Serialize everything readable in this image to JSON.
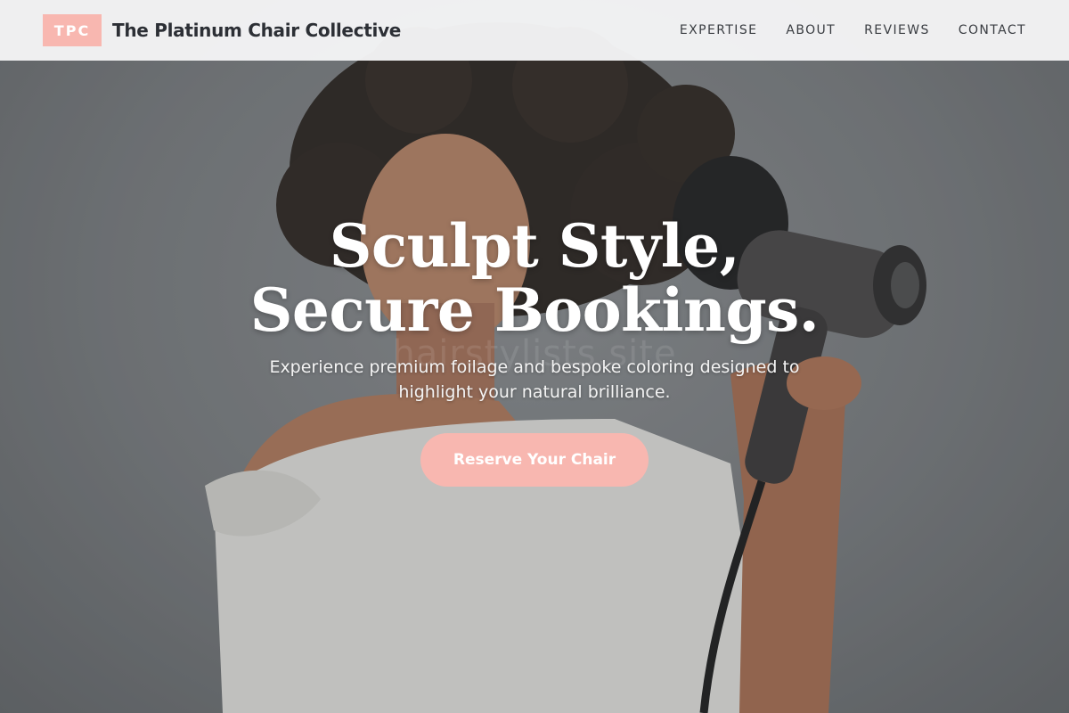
{
  "header": {
    "logo_text": "TPC",
    "brand_name": "The Platinum Chair Collective",
    "nav": [
      {
        "label": "EXPERTISE"
      },
      {
        "label": "ABOUT"
      },
      {
        "label": "REVIEWS"
      },
      {
        "label": "CONTACT"
      }
    ]
  },
  "hero": {
    "headline_line1": "Sculpt Style,",
    "headline_line2": "Secure Bookings.",
    "subtext": "Experience premium foilage and bespoke coloring designed to highlight your natural brilliance.",
    "cta_label": "Reserve Your Chair",
    "watermark": "hairstylists.site",
    "image_icon": "model-with-hair-dryer-photo"
  },
  "colors": {
    "accent": "#f8b7b0",
    "header_bg": "#f4f4f5",
    "brand_text": "#2c2f35",
    "hero_text": "#ffffff"
  }
}
